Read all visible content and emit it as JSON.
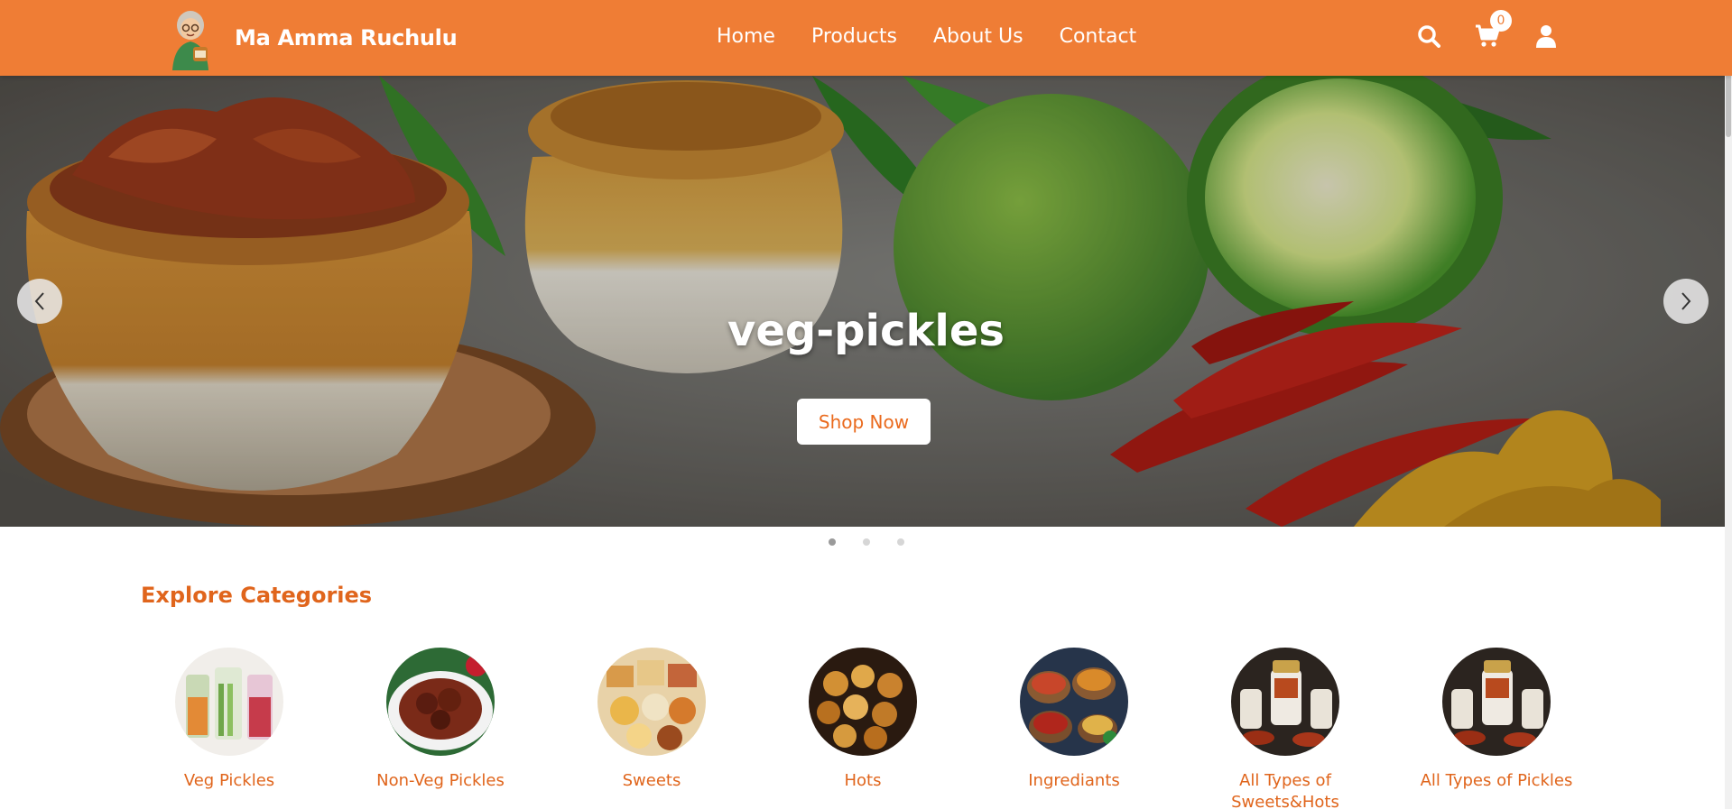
{
  "brand": {
    "name": "Ma Amma Ruchulu",
    "logo_icon": "grandmother-logo-icon"
  },
  "nav": {
    "items": [
      "Home",
      "Products",
      "About Us",
      "Contact"
    ]
  },
  "header_icons": {
    "search": "search-icon",
    "cart": "cart-icon",
    "cart_count": "0",
    "user": "user-icon"
  },
  "hero": {
    "title": "veg-pickles",
    "button_label": "Shop Now",
    "active_slide": 1,
    "slide_count": 3
  },
  "categories": {
    "title": "Explore Categories",
    "items": [
      {
        "label": "Veg Pickles"
      },
      {
        "label": "Non-Veg Pickles"
      },
      {
        "label": "Sweets"
      },
      {
        "label": "Hots"
      },
      {
        "label": "Ingrediants"
      },
      {
        "label": "All Types of Sweets&Hots"
      },
      {
        "label": "All Types of Pickles"
      }
    ]
  },
  "colors": {
    "header": "#ef7d35",
    "accent": "#e0651c",
    "hero_bg": "#6b6b68"
  }
}
